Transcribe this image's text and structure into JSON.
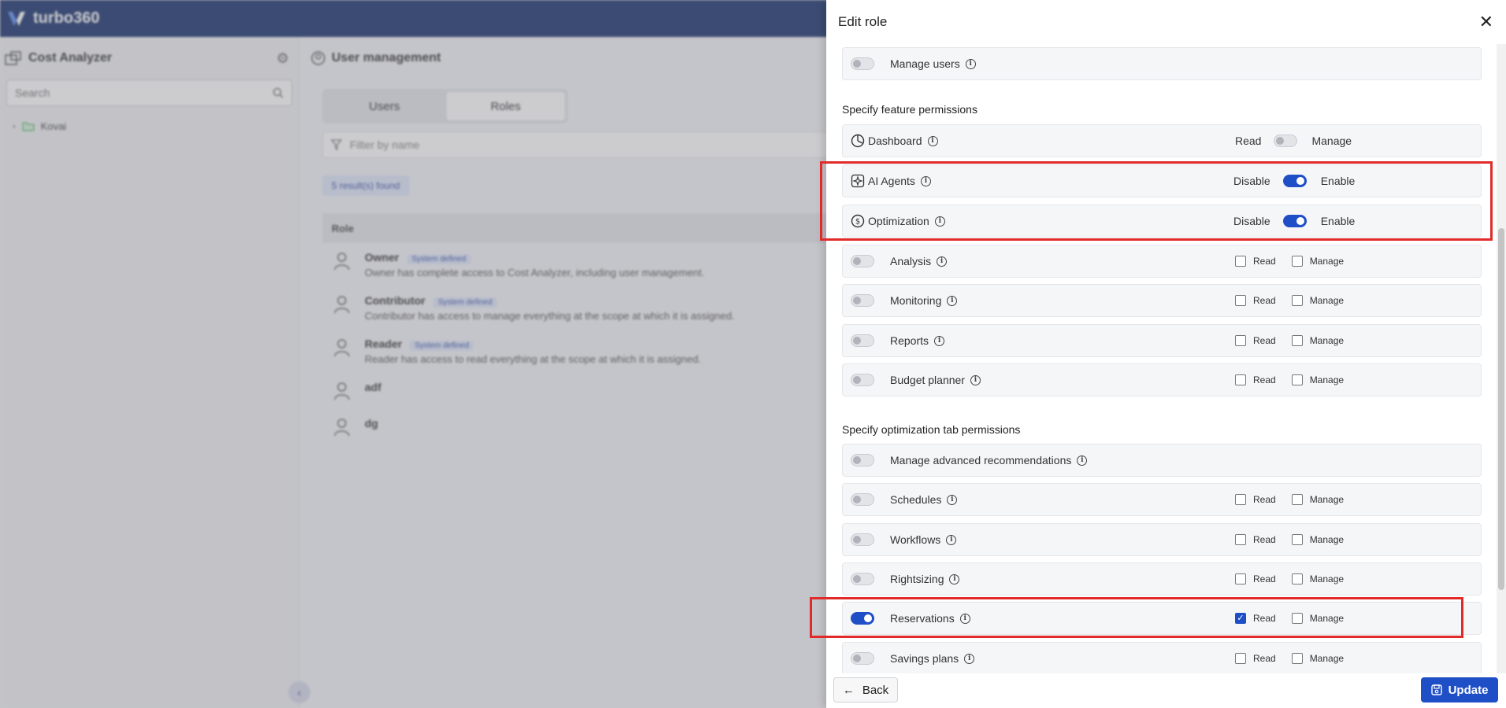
{
  "app": {
    "brand": "turbo360"
  },
  "sidebar": {
    "title": "Cost Analyzer",
    "search_placeholder": "Search",
    "tree_item": "Kovai"
  },
  "main": {
    "title": "User management",
    "tabs": [
      {
        "label": "Users"
      },
      {
        "label": "Roles"
      }
    ],
    "filter_placeholder": "Filter by name",
    "results": "5 result(s) found",
    "column_role": "Role",
    "badge": "System defined",
    "roles": [
      {
        "name": "Owner",
        "desc": "Owner has complete access to Cost Analyzer, including user management."
      },
      {
        "name": "Contributor",
        "desc": "Contributor has access to manage everything at the scope at which it is assigned."
      },
      {
        "name": "Reader",
        "desc": "Reader has access to read everything at the scope at which it is assigned."
      },
      {
        "name": "adf",
        "desc": ""
      },
      {
        "name": "dg",
        "desc": ""
      }
    ]
  },
  "drawer": {
    "title": "Edit role",
    "manage_users": "Manage users",
    "feature_section": "Specify feature permissions",
    "optimization_section": "Specify optimization tab permissions",
    "read_label": "Read",
    "manage_label": "Manage",
    "disable_label": "Disable",
    "enable_label": "Enable",
    "dashboard": "Dashboard",
    "ai_agents": "AI Agents",
    "optimization": "Optimization",
    "features": [
      "Analysis",
      "Monitoring",
      "Reports",
      "Budget planner"
    ],
    "manage_advanced": "Manage advanced recommendations",
    "opt_items": [
      "Schedules",
      "Workflows",
      "Rightsizing",
      "Reservations",
      "Savings plans"
    ],
    "back": "Back",
    "update": "Update"
  },
  "colors": {
    "brand": "#16306b",
    "accent": "#1f4fc7",
    "highlight": "#e12b2b"
  }
}
